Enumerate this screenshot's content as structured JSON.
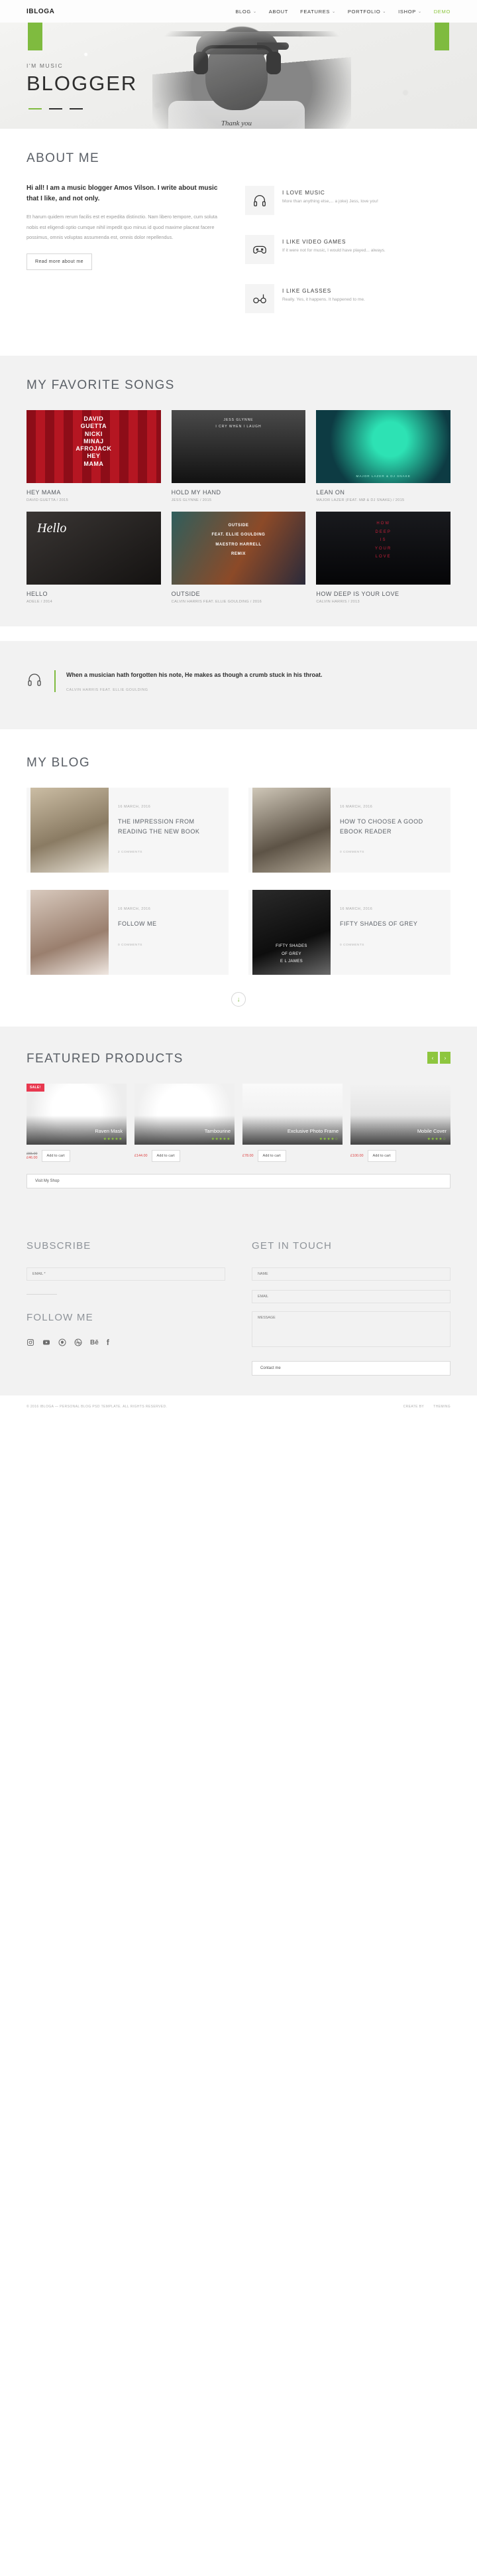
{
  "header": {
    "logo": "IBLOGA",
    "nav": [
      {
        "label": "BLOG",
        "caret": "⌄",
        "accent": false
      },
      {
        "label": "ABOUT",
        "caret": "",
        "accent": false
      },
      {
        "label": "FEATURES",
        "caret": "⌄",
        "accent": false
      },
      {
        "label": "PORTFOLIO",
        "caret": "⌄",
        "accent": false
      },
      {
        "label": "ISHOP",
        "caret": "⌄",
        "accent": false
      },
      {
        "label": "DEMO",
        "caret": "",
        "accent": true
      }
    ]
  },
  "hero": {
    "kicker": "I'M MUSIC",
    "title": "BLOGGER",
    "tee_text": "Thank\nyou",
    "accent": "#7fbb3f",
    "slides": 3,
    "active_slide": 1
  },
  "about": {
    "title": "ABOUT ME",
    "lead": "Hi all! I am a music blogger Amos Vilson. I write about music that I like, and not only.",
    "body": "Et harum quidem rerum facilis est et expedita distinctio. Nam libero tempore, cum soluta nobis est eligendi optio cumque nihil impedit quo minus id quod maxime placeat facere possimus, omnis voluptas assumenda est, omnis dolor repellendus.",
    "button": "Read more about me",
    "features": [
      {
        "icon": "headphones-icon",
        "title": "I LOVE MUSIC",
        "text": "More than anything else,... a joke) Jess, love you!"
      },
      {
        "icon": "gamepad-icon",
        "title": "I LIKE VIDEO GAMES",
        "text": "If it were not for music, I would have played... always."
      },
      {
        "icon": "glasses-icon",
        "title": "I LIKE GLASSES",
        "text": "Really. Yes, it happens. It happened to me."
      }
    ]
  },
  "songs": {
    "title": "MY FAVORITE SONGS",
    "items": [
      {
        "name": "HEY MAMA",
        "meta": "DAVID GUETTA / 2015",
        "cover": "cover-hey"
      },
      {
        "name": "HOLD MY HAND",
        "meta": "JESS GLYNNE / 2015",
        "cover": "cover-hold"
      },
      {
        "name": "LEAN ON",
        "meta": "MAJOR LAZER (FEAT. MØ & DJ SNAKE) / 2015",
        "cover": "cover-lean"
      },
      {
        "name": "HELLO",
        "meta": "ADELE / 2014",
        "cover": "cover-hello"
      },
      {
        "name": "OUTSIDE",
        "meta": "CALVIN HARRIS FEAT. ELLIE GOULDING  / 2016",
        "cover": "cover-out"
      },
      {
        "name": "HOW DEEP IS YOUR LOVE",
        "meta": "CALVIN HARRIS / 2013",
        "cover": "cover-deep"
      }
    ]
  },
  "quote": {
    "icon": "headphones-icon",
    "text": "When a musician hath forgotten his note, He makes as though a crumb stuck in his throat.",
    "cite": "CALVIN HARRIS FEAT. ELLIE GOULDING"
  },
  "blog": {
    "title": "MY BLOG",
    "posts": [
      {
        "date": "16 MARCH, 2016",
        "title": "THE IMPRESSION FROM READING THE NEW BOOK",
        "comments": "2 COMMENTS",
        "img": "bimg-1"
      },
      {
        "date": "16 MARCH, 2016",
        "title": "HOW TO CHOOSE A GOOD EBOOK READER",
        "comments": "0 COMMENTS",
        "img": "bimg-2"
      },
      {
        "date": "16 MARCH, 2016",
        "title": "FOLLOW ME",
        "comments": "0 COMMENTS",
        "img": "bimg-3"
      },
      {
        "date": "16 MARCH, 2016",
        "title": "FIFTY SHADES OF GREY",
        "comments": "0 COMMENTS",
        "img": "bimg-4"
      }
    ],
    "more_icon": "arrow-down-icon"
  },
  "products": {
    "title": "FEATURED PRODUCTS",
    "prev_icon": "chevron-left-icon",
    "next_icon": "chevron-right-icon",
    "visit_shop": "Visit My Shop",
    "items": [
      {
        "name": "Raven Mask",
        "stars": "★★★★★",
        "price_old": "£55.00",
        "price_new": "£46.00",
        "sale": "SALE!",
        "cart": "Add to cart",
        "img": "pi-1"
      },
      {
        "name": "Tambourine",
        "stars": "★★★★★",
        "price_old": "",
        "price_new": "£144.00",
        "sale": "",
        "cart": "Add to cart",
        "img": "pi-2"
      },
      {
        "name": "Exclusive Photo Frame",
        "stars": "★★★★☆",
        "price_old": "",
        "price_new": "£78.00",
        "sale": "",
        "cart": "Add to cart",
        "img": "pi-3"
      },
      {
        "name": "Mobile Cover",
        "stars": "★★★★☆",
        "price_old": "",
        "price_new": "£100.00",
        "sale": "",
        "cart": "Add to cart",
        "img": "pi-4"
      }
    ]
  },
  "footer": {
    "subscribe_title": "SUBSCRIBE",
    "subscribe_placeholder": "EMAIL *",
    "follow_title": "FOLLOW ME",
    "socials": [
      "instagram-icon",
      "youtube-icon",
      "pinterest-icon",
      "dribbble-icon",
      "behance-icon",
      "facebook-icon"
    ],
    "contact_title": "GET IN TOUCH",
    "name_placeholder": "NAME",
    "email_placeholder": "EMAIL",
    "message_placeholder": "MESSAGE",
    "contact_button": "Contact me",
    "copyright": "© 2016 IBLOGA — PERSONAL BLOG PSD TEMPLATE. ALL RIGHTS RESERVED.",
    "link_1": "CREATE BY",
    "link_2": "THEMING"
  }
}
